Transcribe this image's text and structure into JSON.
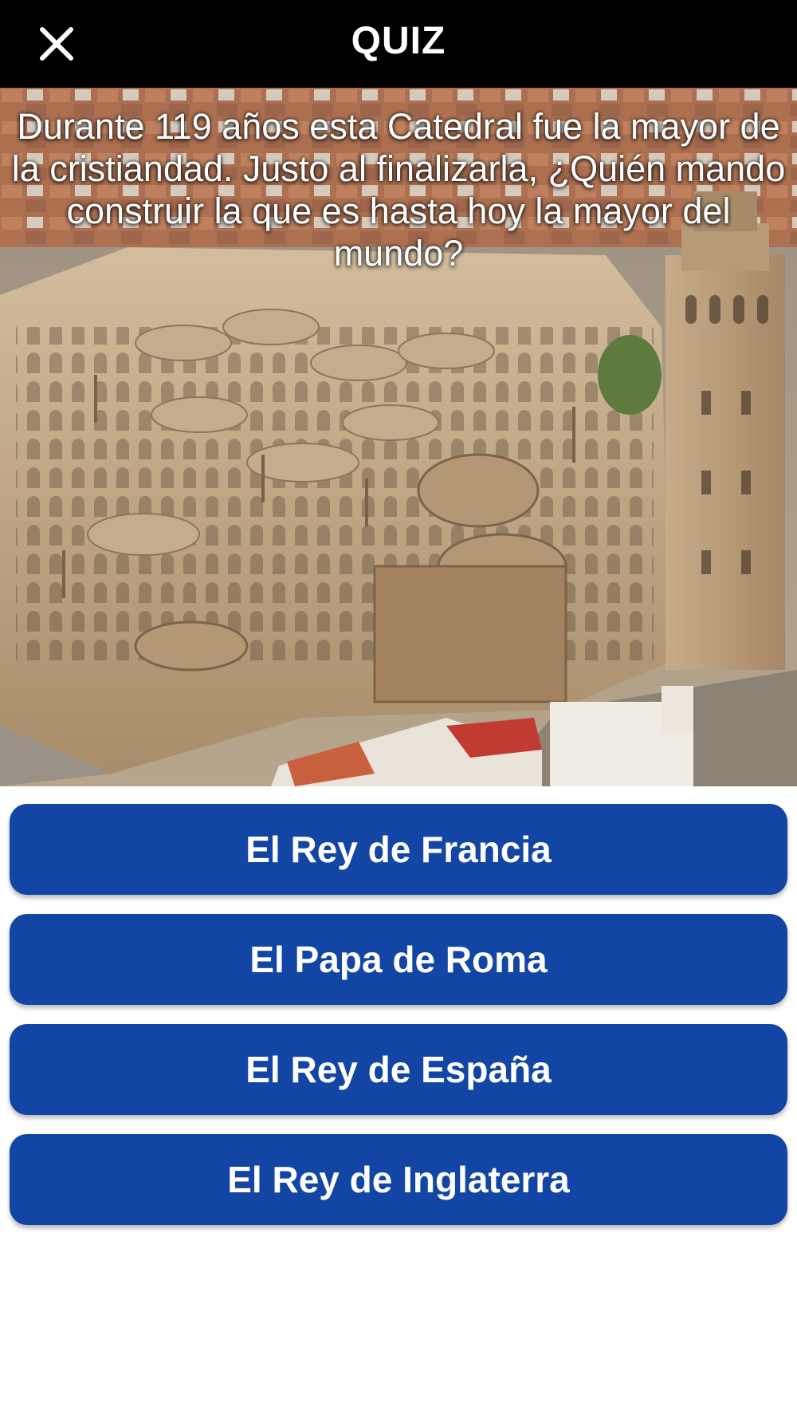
{
  "header": {
    "title": "QUIZ",
    "close_icon": "close-icon"
  },
  "question": {
    "text": "Durante 119 años esta Catedral fue la mayor de la cristiandad. Justo al finalizarla, ¿Quién mando construir la que es hasta hoy la mayor del mundo?"
  },
  "answers": [
    {
      "label": "El Rey de Francia"
    },
    {
      "label": "El Papa de Roma"
    },
    {
      "label": "El Rey de España"
    },
    {
      "label": "El Rey de Inglaterra"
    }
  ],
  "colors": {
    "header_bg": "#000000",
    "answer_bg": "#1245a4",
    "answer_text": "#ffffff",
    "question_text": "#ffffff"
  }
}
